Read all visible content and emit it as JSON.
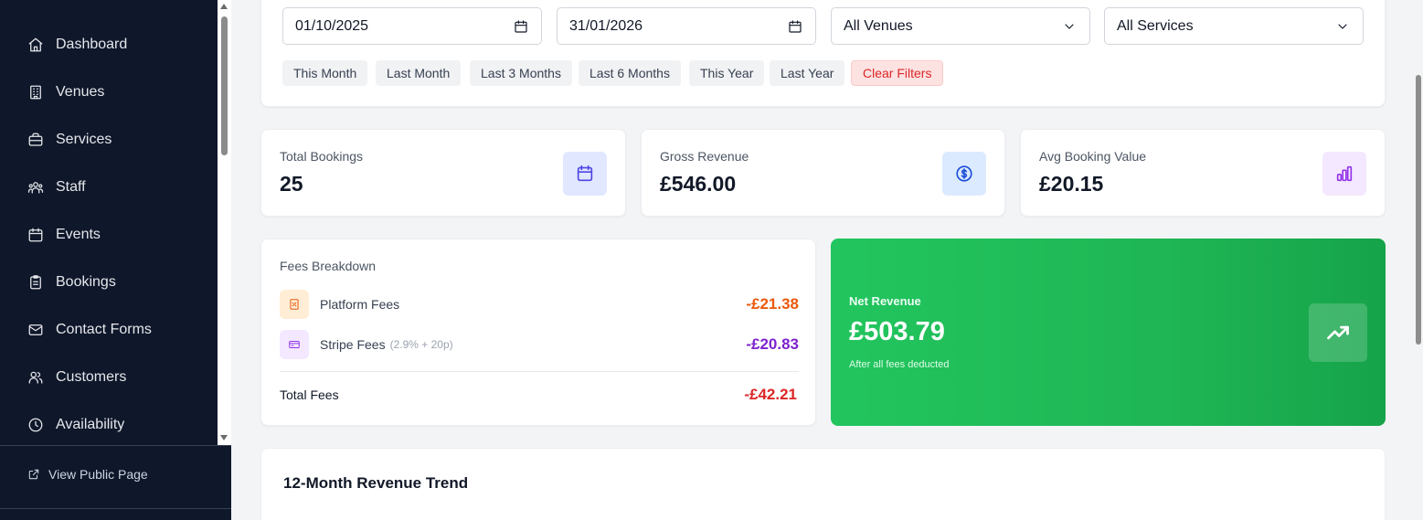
{
  "sidebar": {
    "items": [
      {
        "label": "Dashboard",
        "icon": "home-icon"
      },
      {
        "label": "Venues",
        "icon": "building-icon"
      },
      {
        "label": "Services",
        "icon": "briefcase-icon"
      },
      {
        "label": "Staff",
        "icon": "users-icon"
      },
      {
        "label": "Events",
        "icon": "calendar-icon"
      },
      {
        "label": "Bookings",
        "icon": "clipboard-icon"
      },
      {
        "label": "Contact Forms",
        "icon": "mail-icon"
      },
      {
        "label": "Customers",
        "icon": "customers-icon"
      },
      {
        "label": "Availability",
        "icon": "clock-icon"
      }
    ],
    "public_link": "View Public Page"
  },
  "filters": {
    "start_date": "01/10/2025",
    "end_date": "31/01/2026",
    "venue": "All Venues",
    "service": "All Services",
    "presets": [
      "This Month",
      "Last Month",
      "Last 3 Months",
      "Last 6 Months",
      "This Year",
      "Last Year"
    ],
    "clear_label": "Clear Filters"
  },
  "stats": {
    "total_bookings": {
      "label": "Total Bookings",
      "value": "25"
    },
    "gross_revenue": {
      "label": "Gross Revenue",
      "value": "£546.00"
    },
    "avg_booking_value": {
      "label": "Avg Booking Value",
      "value": "£20.15"
    }
  },
  "fees": {
    "title": "Fees Breakdown",
    "platform": {
      "label": "Platform Fees",
      "value": "-£21.38"
    },
    "stripe": {
      "label": "Stripe Fees",
      "note": "(2.9% + 20p)",
      "value": "-£20.83"
    },
    "total": {
      "label": "Total Fees",
      "value": "-£42.21"
    }
  },
  "net_revenue": {
    "label": "Net Revenue",
    "value": "£503.79",
    "subtitle": "After all fees deducted"
  },
  "trend": {
    "title": "12-Month Revenue Trend"
  },
  "colors": {
    "sidebar_bg": "#0f172a",
    "net_green": "#22c55e",
    "platform_fee": "#ea580c",
    "stripe_fee": "#7e22ce",
    "total_fee": "#dc2626"
  }
}
